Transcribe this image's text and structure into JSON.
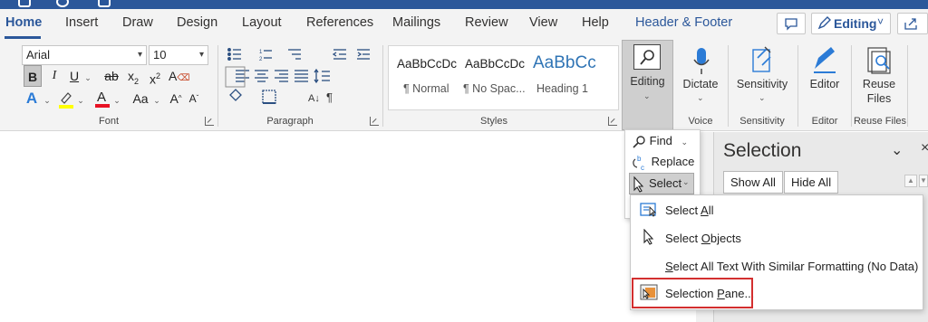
{
  "tabs": [
    "Home",
    "Insert",
    "Draw",
    "Design",
    "Layout",
    "References",
    "Mailings",
    "Review",
    "View",
    "Help"
  ],
  "contextual_tab": "Header & Footer",
  "top_right": {
    "editing_label": "Editing",
    "editing_chevron": "˅"
  },
  "font": {
    "name": "Arial",
    "size": "10"
  },
  "groups": {
    "font": "Font",
    "paragraph": "Paragraph",
    "styles": "Styles",
    "voice": "Voice",
    "sensitivity": "Sensitivity",
    "editor": "Editor",
    "reuse_files": "Reuse Files"
  },
  "styles": [
    {
      "preview": "AaBbCcDc",
      "name": "¶ Normal"
    },
    {
      "preview": "AaBbCcDc",
      "name": "¶ No Spac..."
    },
    {
      "preview": "AaBbCc",
      "name": "Heading 1"
    }
  ],
  "big_buttons": {
    "editing": "Editing",
    "dictate": "Dictate",
    "sensitivity": "Sensitivity",
    "editor": "Editor",
    "reuse_files_line1": "Reuse",
    "reuse_files_line2": "Files"
  },
  "editing_menu": {
    "find": "Find",
    "replace": "Replace",
    "select": "Select"
  },
  "select_menu": {
    "select_all": {
      "pre": "Select ",
      "ul": "A",
      "post": "ll"
    },
    "select_objects": {
      "pre": "Select ",
      "ul": "O",
      "post": "bjects"
    },
    "select_similar": {
      "pre": "",
      "ul": "S",
      "post": "elect All Text With Similar Formatting (No Data)"
    },
    "selection_pane": {
      "pre": "Selection ",
      "ul": "P",
      "post": "ane..."
    }
  },
  "pane": {
    "title": "Selection",
    "show_all": "Show All",
    "hide_all": "Hide All"
  },
  "colors": {
    "brand": "#2b579a",
    "highlight_border": "#d32f2f"
  },
  "icons": [
    "search-icon",
    "microphone-icon",
    "sensitivity-icon",
    "editor-pen-icon",
    "reuse-files-icon",
    "replace-icon",
    "cursor-icon",
    "select-all-icon",
    "selection-pane-icon"
  ]
}
